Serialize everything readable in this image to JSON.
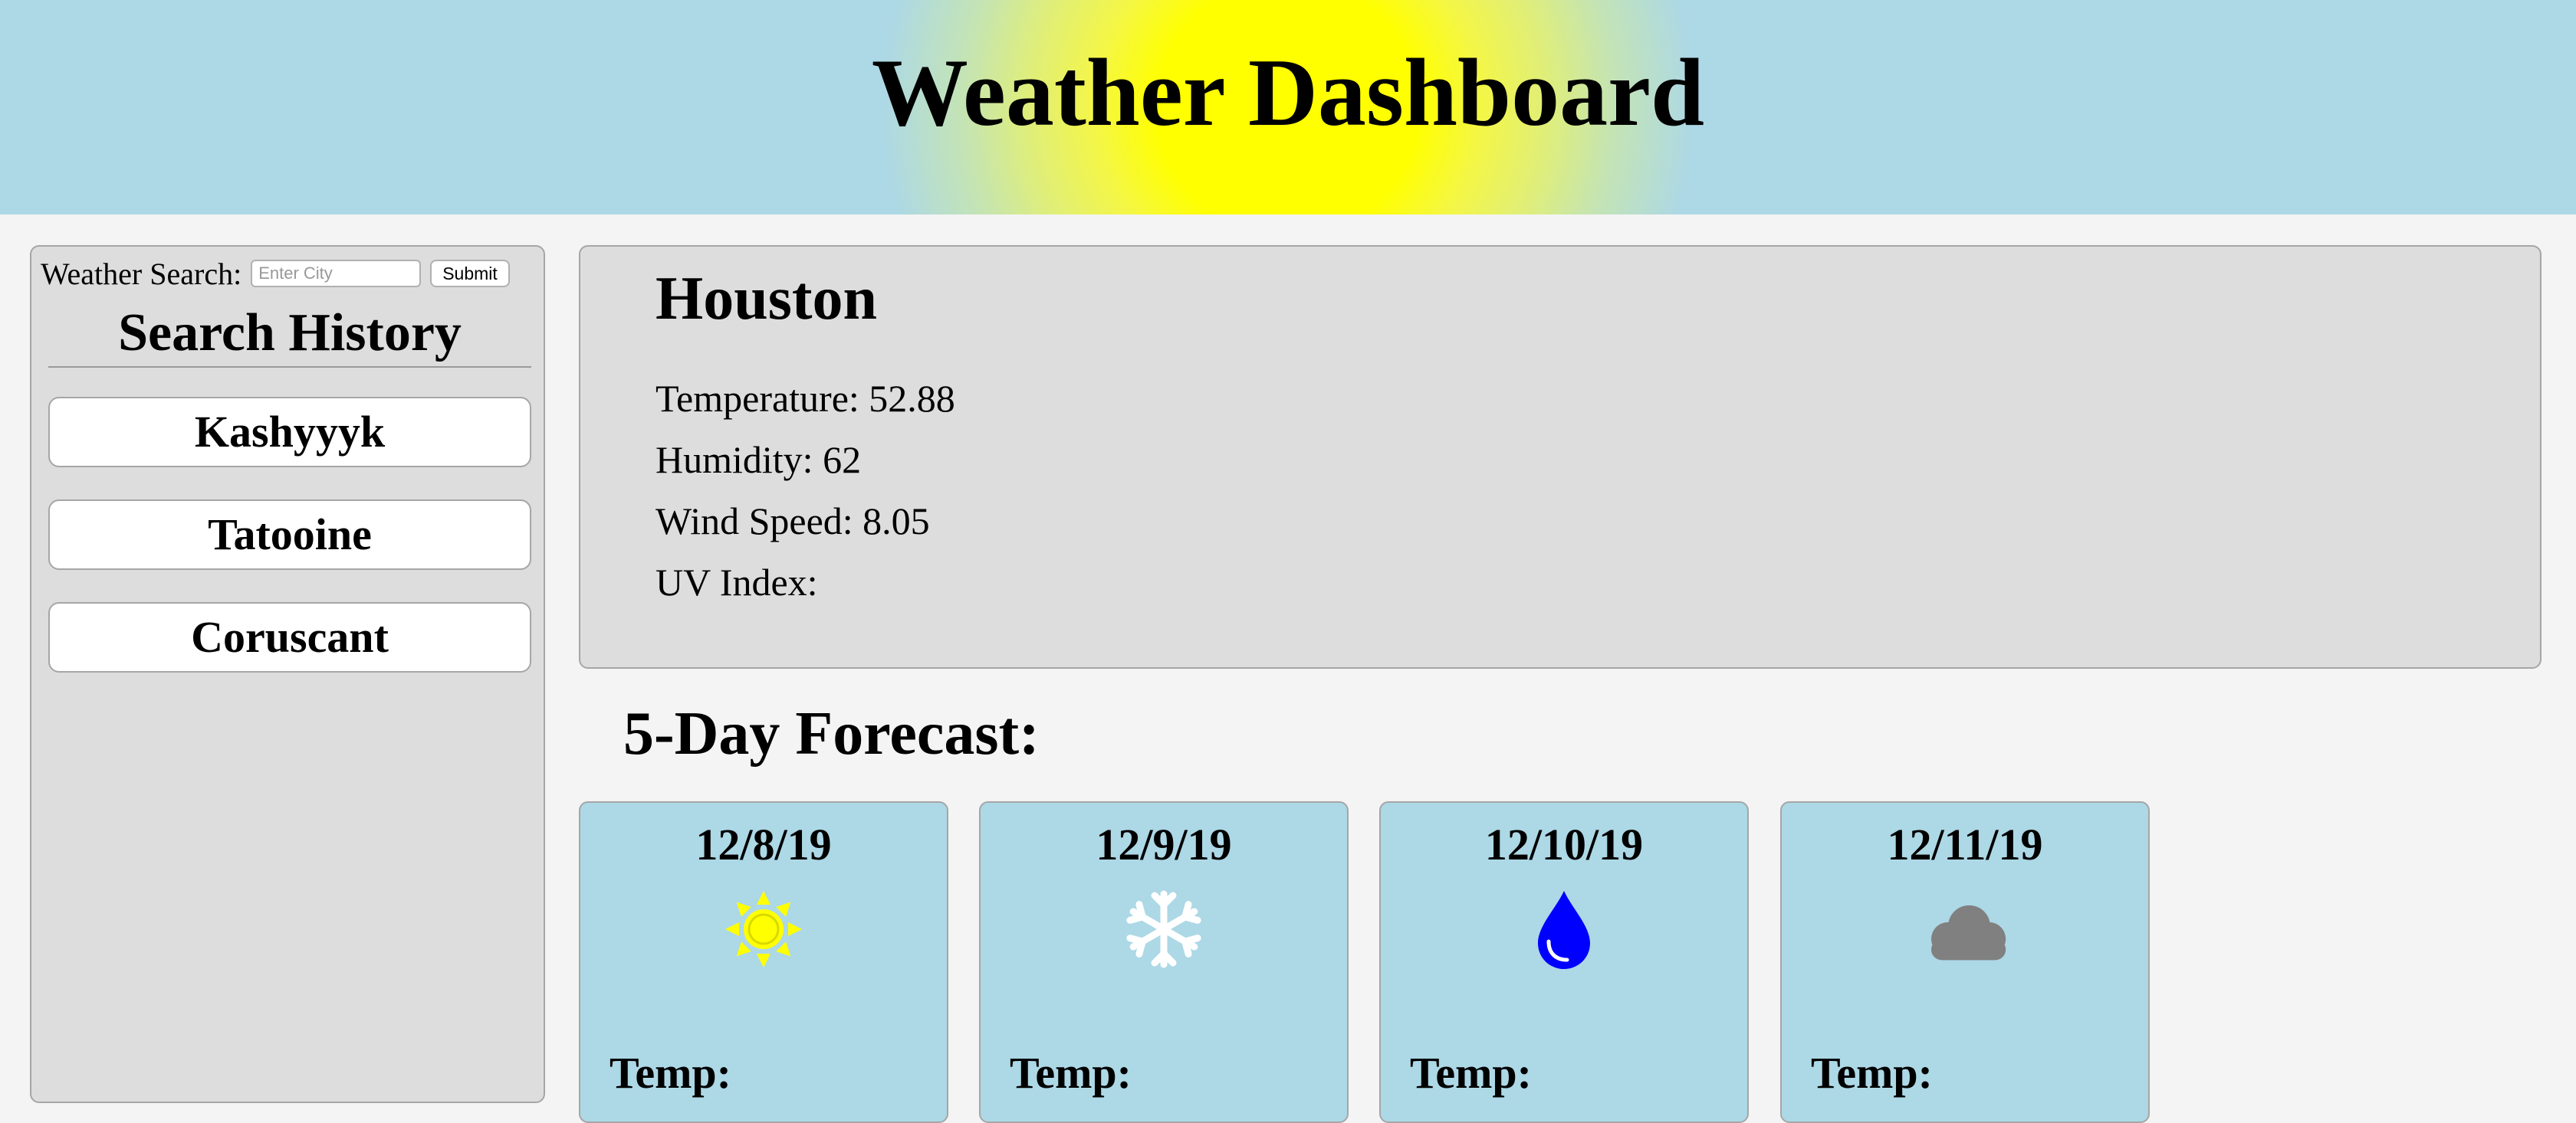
{
  "header": {
    "title": "Weather Dashboard",
    "bg_color": "#add8e6",
    "sun_color": "#ffff00"
  },
  "search": {
    "label": "Weather Search:",
    "placeholder": "Enter City",
    "submit_label": "Submit"
  },
  "history": {
    "title": "Search History",
    "items": [
      {
        "label": "Kashyyyk"
      },
      {
        "label": "Tatooine"
      },
      {
        "label": "Coruscant"
      }
    ]
  },
  "current": {
    "city": "Houston",
    "temperature": "Temperature: 52.88",
    "humidity": "Humidity: 62",
    "wind_speed": "Wind Speed: 8.05",
    "uv_index": "UV Index:"
  },
  "forecast": {
    "title": "5-Day Forecast:",
    "days": [
      {
        "date": "12/8/19",
        "icon": "sun-icon",
        "icon_color": "#ffff00",
        "temp_label": "Temp:"
      },
      {
        "date": "12/9/19",
        "icon": "snowflake-icon",
        "icon_color": "#ffffff",
        "temp_label": "Temp:"
      },
      {
        "date": "12/10/19",
        "icon": "raindrop-icon",
        "icon_color": "#0000ff",
        "temp_label": "Temp:"
      },
      {
        "date": "12/11/19",
        "icon": "cloud-icon",
        "icon_color": "#808080",
        "temp_label": "Temp:"
      }
    ]
  }
}
